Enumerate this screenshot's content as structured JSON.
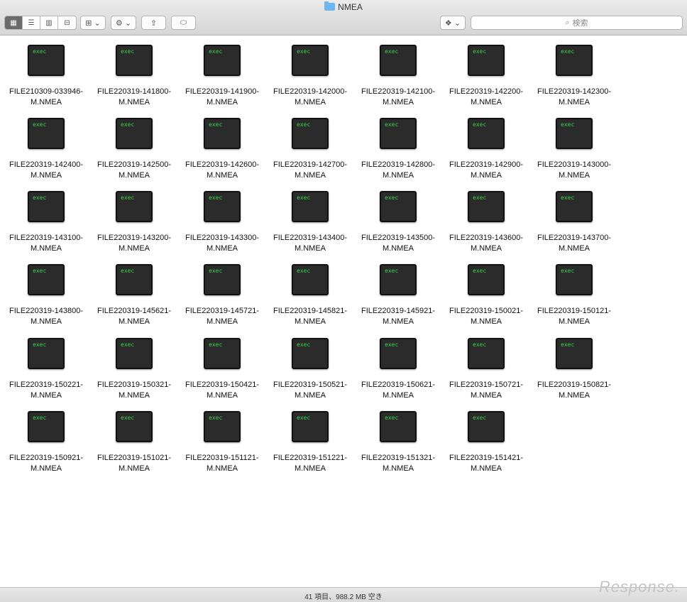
{
  "window": {
    "title": "NMEA"
  },
  "toolbar": {
    "view_buttons": [
      "icon-view-icon",
      "list-view-icon",
      "column-view-icon",
      "coverflow-view-icon"
    ],
    "arrange_label": "⊞ ⌄",
    "action_label": "⚙ ⌄",
    "share_label": "⇪",
    "tag_label": "⬭",
    "dropbox_label": "❖ ⌄",
    "search_placeholder": "検索"
  },
  "files": [
    {
      "name": "FILE210309-033946-M.NMEA",
      "icon_text": "exec"
    },
    {
      "name": "FILE220319-141800-M.NMEA",
      "icon_text": "exec"
    },
    {
      "name": "FILE220319-141900-M.NMEA",
      "icon_text": "exec"
    },
    {
      "name": "FILE220319-142000-M.NMEA",
      "icon_text": "exec"
    },
    {
      "name": "FILE220319-142100-M.NMEA",
      "icon_text": "exec"
    },
    {
      "name": "FILE220319-142200-M.NMEA",
      "icon_text": "exec"
    },
    {
      "name": "FILE220319-142300-M.NMEA",
      "icon_text": "exec"
    },
    {
      "name": "FILE220319-142400-M.NMEA",
      "icon_text": "exec"
    },
    {
      "name": "FILE220319-142500-M.NMEA",
      "icon_text": "exec"
    },
    {
      "name": "FILE220319-142600-M.NMEA",
      "icon_text": "exec"
    },
    {
      "name": "FILE220319-142700-M.NMEA",
      "icon_text": "exec"
    },
    {
      "name": "FILE220319-142800-M.NMEA",
      "icon_text": "exec"
    },
    {
      "name": "FILE220319-142900-M.NMEA",
      "icon_text": "exec"
    },
    {
      "name": "FILE220319-143000-M.NMEA",
      "icon_text": "exec"
    },
    {
      "name": "FILE220319-143100-M.NMEA",
      "icon_text": "exec"
    },
    {
      "name": "FILE220319-143200-M.NMEA",
      "icon_text": "exec"
    },
    {
      "name": "FILE220319-143300-M.NMEA",
      "icon_text": "exec"
    },
    {
      "name": "FILE220319-143400-M.NMEA",
      "icon_text": "exec"
    },
    {
      "name": "FILE220319-143500-M.NMEA",
      "icon_text": "exec"
    },
    {
      "name": "FILE220319-143600-M.NMEA",
      "icon_text": "exec"
    },
    {
      "name": "FILE220319-143700-M.NMEA",
      "icon_text": "exec"
    },
    {
      "name": "FILE220319-143800-M.NMEA",
      "icon_text": "exec"
    },
    {
      "name": "FILE220319-145621-M.NMEA",
      "icon_text": "exec"
    },
    {
      "name": "FILE220319-145721-M.NMEA",
      "icon_text": "exec"
    },
    {
      "name": "FILE220319-145821-M.NMEA",
      "icon_text": "exec"
    },
    {
      "name": "FILE220319-145921-M.NMEA",
      "icon_text": "exec"
    },
    {
      "name": "FILE220319-150021-M.NMEA",
      "icon_text": "exec"
    },
    {
      "name": "FILE220319-150121-M.NMEA",
      "icon_text": "exec"
    },
    {
      "name": "FILE220319-150221-M.NMEA",
      "icon_text": "exec"
    },
    {
      "name": "FILE220319-150321-M.NMEA",
      "icon_text": "exec"
    },
    {
      "name": "FILE220319-150421-M.NMEA",
      "icon_text": "exec"
    },
    {
      "name": "FILE220319-150521-M.NMEA",
      "icon_text": "exec"
    },
    {
      "name": "FILE220319-150621-M.NMEA",
      "icon_text": "exec"
    },
    {
      "name": "FILE220319-150721-M.NMEA",
      "icon_text": "exec"
    },
    {
      "name": "FILE220319-150821-M.NMEA",
      "icon_text": "exec"
    },
    {
      "name": "FILE220319-150921-M.NMEA",
      "icon_text": "exec"
    },
    {
      "name": "FILE220319-151021-M.NMEA",
      "icon_text": "exec"
    },
    {
      "name": "FILE220319-151121-M.NMEA",
      "icon_text": "exec"
    },
    {
      "name": "FILE220319-151221-M.NMEA",
      "icon_text": "exec"
    },
    {
      "name": "FILE220319-151321-M.NMEA",
      "icon_text": "exec"
    },
    {
      "name": "FILE220319-151421-M.NMEA",
      "icon_text": "exec"
    }
  ],
  "status": {
    "text": "41 項目、988.2 MB 空き"
  },
  "watermark": {
    "text": "Response."
  }
}
